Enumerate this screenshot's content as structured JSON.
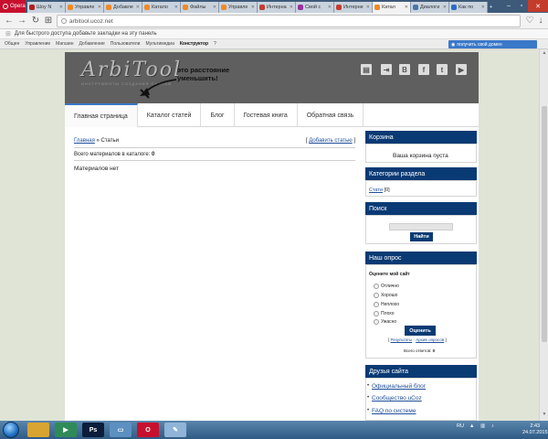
{
  "browser": {
    "opera_label": "Opera",
    "tabs": [
      {
        "label": "Шоу N",
        "fav": "#b21f1f"
      },
      {
        "label": "Управле",
        "fav": "#f08a24"
      },
      {
        "label": "Добавле",
        "fav": "#f08a24"
      },
      {
        "label": "Катало",
        "fav": "#f08a24"
      },
      {
        "label": "Файлы",
        "fav": "#f08a24"
      },
      {
        "label": "Управле",
        "fav": "#f08a24"
      },
      {
        "label": "Интерна",
        "fav": "#c43c2c"
      },
      {
        "label": "Свой с",
        "fav": "#9a2fa3"
      },
      {
        "label": "Интерне",
        "fav": "#c43c2c"
      },
      {
        "label": "Катал",
        "fav": "#f08a24"
      },
      {
        "label": "Диалоги",
        "fav": "#4a76a8"
      },
      {
        "label": "Как по",
        "fav": "#2a6ac8"
      }
    ],
    "url": "arbitool.ucoz.net",
    "bookmarks_hint": "Для быстрого доступа добавьте закладки на эту панель"
  },
  "ucoz_toolbar": {
    "items": [
      "Общее",
      "Управление",
      "Магазин",
      "Добавление",
      "Пользователи",
      "Мультимедиа"
    ],
    "constructor_label": "Конструктор",
    "help_label": "?",
    "domain_button": "получить свой домен"
  },
  "site": {
    "logo_text": "ArbiTool",
    "logo_sub": "ИНСТРУМЕНТЫ  СОЗДАНИЯ  САЙТОВ",
    "annotation_line1": "это расстояние",
    "annotation_line2": "уменьшить!",
    "social": [
      "▤",
      "⇥",
      "В",
      "f",
      "t",
      "▶"
    ],
    "nav": [
      "Главная страница",
      "Каталог статей",
      "Блог",
      "Гостевая книга",
      "Обратная связь"
    ],
    "breadcrumb_home": "Главная",
    "breadcrumb_sep": "»",
    "breadcrumb_current": "Статьи",
    "add_article_open": "[",
    "add_article": "Добавить статью",
    "add_article_close": "]",
    "count_label": "Всего материалов в каталоге:",
    "count_value": "0",
    "no_materials": "Материалов нет"
  },
  "sidebar": {
    "cart_title": "Корзина",
    "cart_empty": "Ваша корзина пуста",
    "categories_title": "Категории раздела",
    "category_name": "Стати",
    "category_count": "[0]",
    "search_title": "Поиск",
    "search_button": "Найти",
    "poll_title": "Наш опрос",
    "poll_question": "Оцените мой сайт",
    "poll_options": [
      "Отлично",
      "Хорошо",
      "Неплохо",
      "Плохо",
      "Ужасно"
    ],
    "rate_button": "Оценить",
    "poll_results": "Результаты",
    "poll_archive": "Архив опросов",
    "poll_total_label": "Всего ответов:",
    "poll_total": "0",
    "friends_title": "Друзья сайта",
    "friends": [
      "Официальный блог",
      "Сообщество uCoz",
      "FAQ по системе"
    ]
  },
  "taskbar": {
    "apps": [
      {
        "name": "explorer-icon",
        "label": "",
        "color": "#d9a431"
      },
      {
        "name": "media-player-icon",
        "label": "▶",
        "color": "#2e8b57"
      },
      {
        "name": "photoshop-icon",
        "label": "Ps",
        "color": "#0b1d3a"
      },
      {
        "name": "window-icon",
        "label": "▭",
        "color": "#5d8fc1"
      },
      {
        "name": "opera-taskbar-icon",
        "label": "O",
        "color": "#c8102e"
      },
      {
        "name": "paint-icon",
        "label": "✎",
        "color": "#8fb4d8"
      }
    ],
    "lang": "RU",
    "time": "2:43",
    "date": "24.07.2015"
  },
  "colors": {
    "sidebar_header": "#0a3a74",
    "header_bg": "#5f5f5f",
    "link": "#1f4e9a",
    "accent_blue": "#3a78c8"
  }
}
